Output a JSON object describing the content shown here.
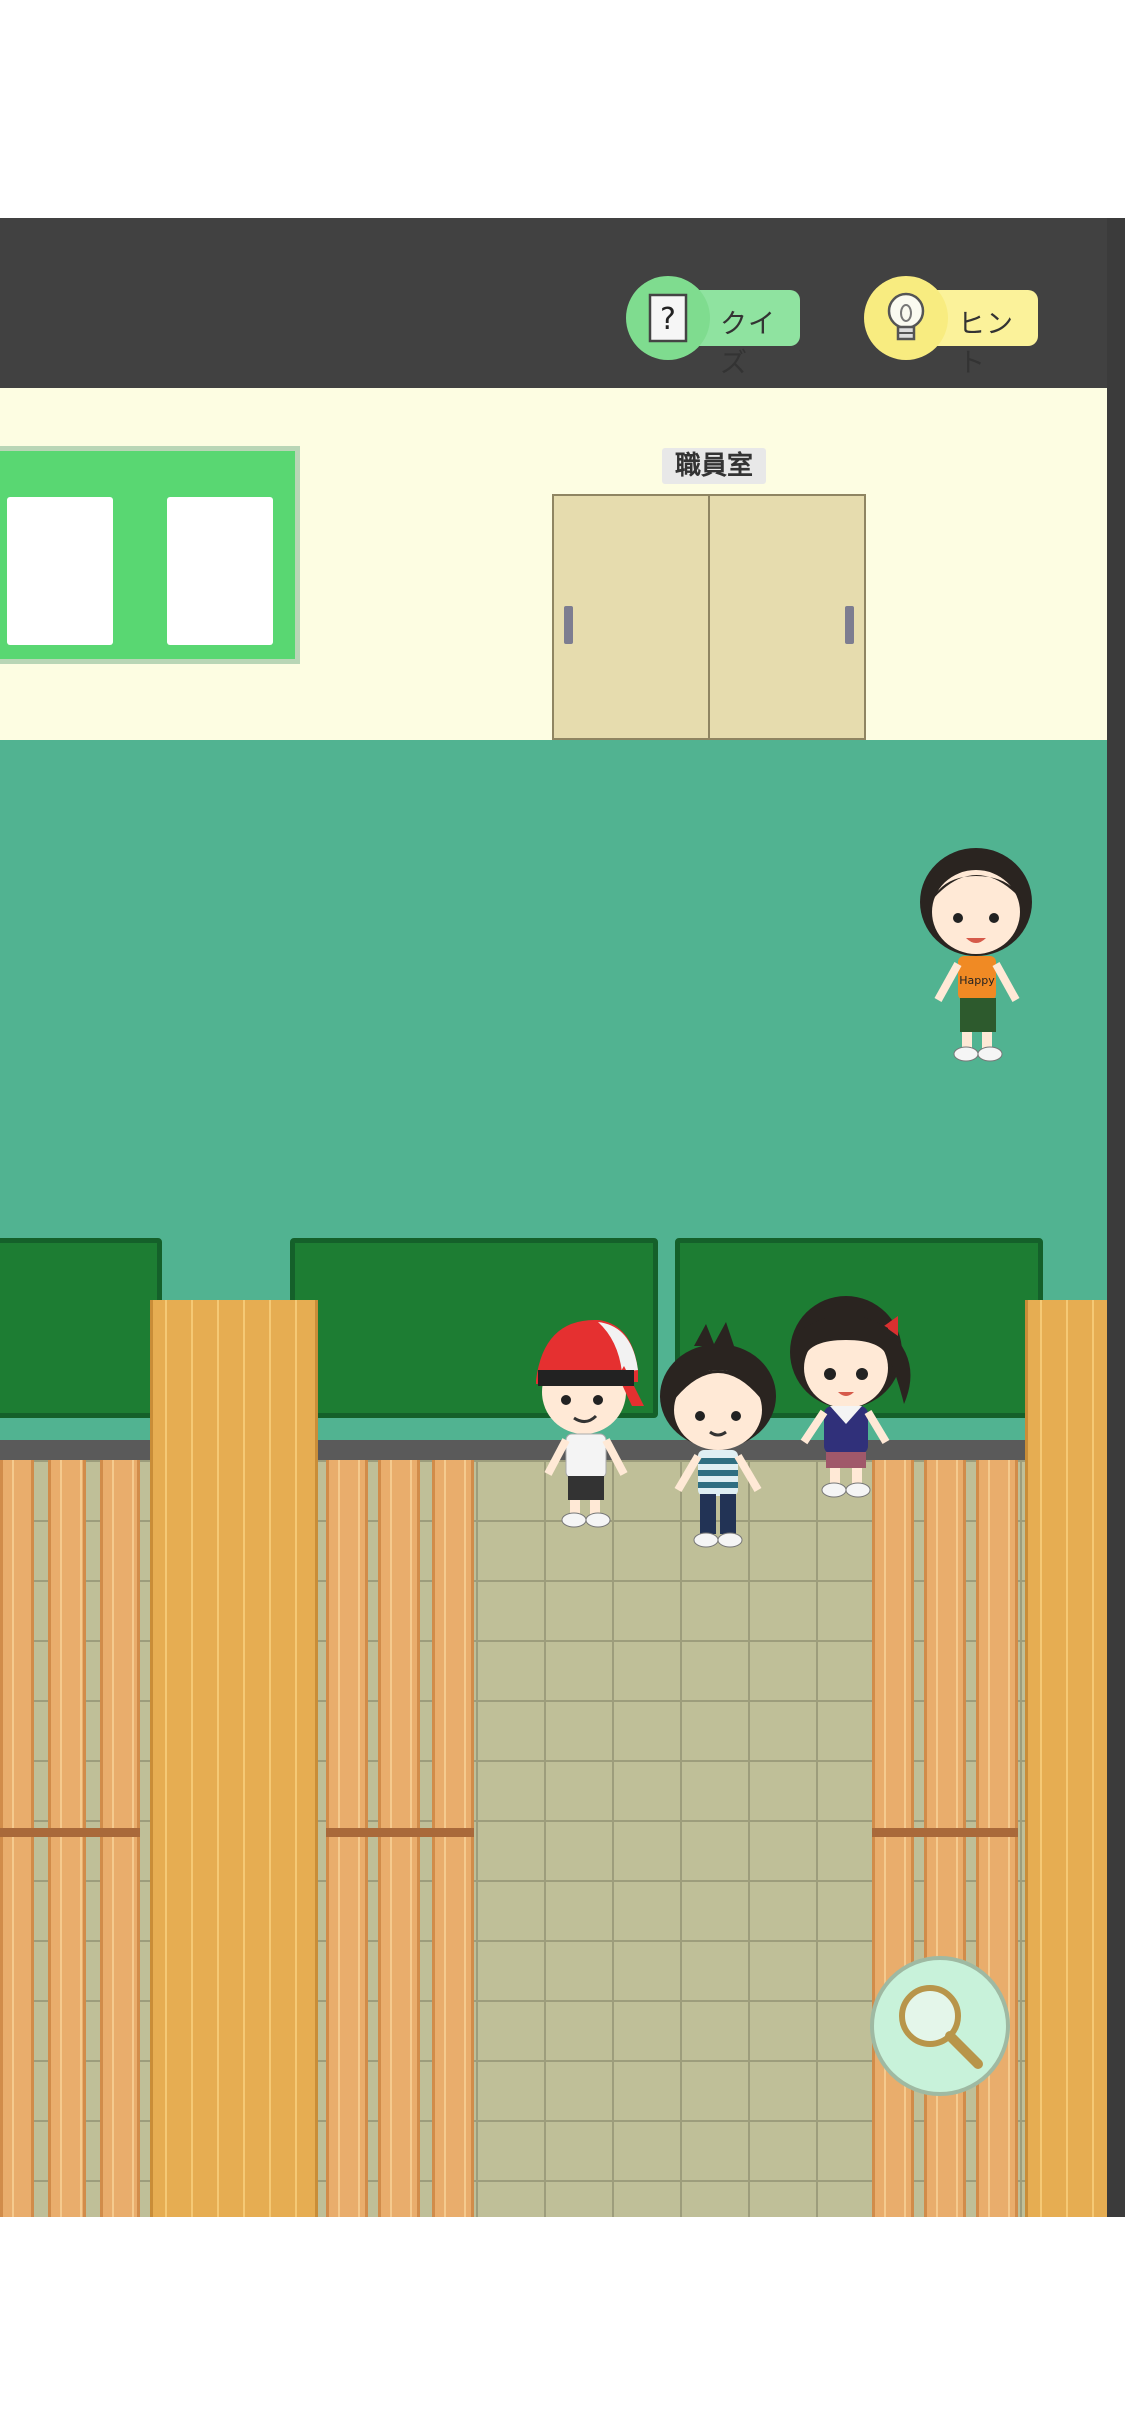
{
  "toolbar": {
    "quiz_label": "クイズ",
    "hint_label": "ヒント",
    "quiz_icon": "question-sheet-icon",
    "hint_icon": "lightbulb-icon"
  },
  "scene": {
    "door_sign": "職員室",
    "shirt_print": "Happy"
  },
  "controls": {
    "zoom_icon": "magnifier-icon"
  },
  "colors": {
    "topbar": "#414141",
    "wall": "#fdfde2",
    "hall": "#51b391",
    "mat": "#1d7d33",
    "quiz_accent": "#8fe3a0",
    "hint_accent": "#fbf29a"
  }
}
